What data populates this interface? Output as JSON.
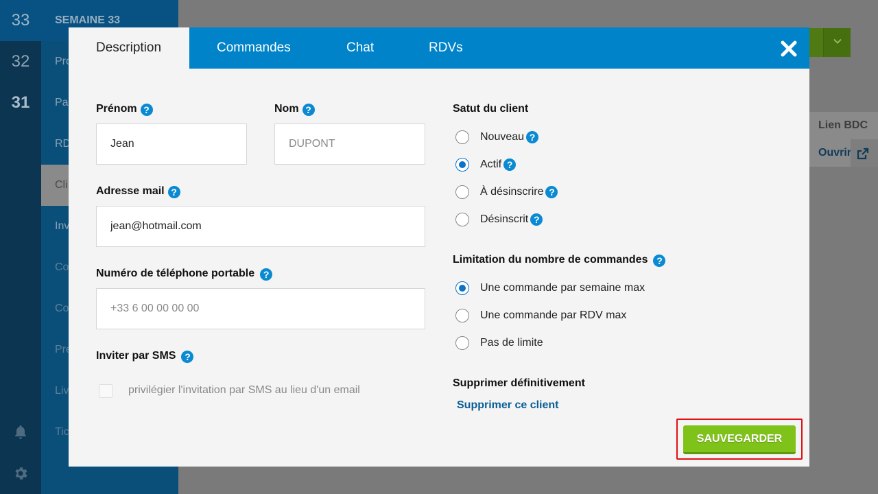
{
  "background": {
    "weeks": [
      {
        "number": "33"
      },
      {
        "number": "32"
      },
      {
        "number": "31"
      }
    ],
    "nav_header": "SEMAINE 33",
    "nav_items": [
      "Pro",
      "Pa",
      "RD",
      "Cli",
      "Inv",
      "Co",
      "Co",
      "Pre",
      "Liv",
      "Tic"
    ],
    "panel": {
      "lien_label": "Lien BDC",
      "ouvrir_label": "Ouvrir"
    }
  },
  "modal": {
    "tabs": [
      {
        "label": "Description",
        "active": true
      },
      {
        "label": "Commandes",
        "active": false
      },
      {
        "label": "Chat",
        "active": false
      },
      {
        "label": "RDVs",
        "active": false
      }
    ],
    "form": {
      "prenom": {
        "label": "Prénom",
        "value": "Jean",
        "placeholder": ""
      },
      "nom": {
        "label": "Nom",
        "value": "",
        "placeholder": "DUPONT"
      },
      "email": {
        "label": "Adresse mail",
        "value": "jean@hotmail.com",
        "placeholder": ""
      },
      "phone": {
        "label": "Numéro de téléphone portable",
        "value": "",
        "placeholder": "+33 6 00 00 00 00"
      },
      "sms": {
        "label": "Inviter par SMS",
        "checkbox_label": "privilégier l'invitation par SMS au lieu d'un email",
        "checked": false
      }
    },
    "status": {
      "label": "Satut du client",
      "options": [
        {
          "label": "Nouveau",
          "checked": false
        },
        {
          "label": "Actif",
          "checked": true
        },
        {
          "label": "À désinscrire",
          "checked": false
        },
        {
          "label": "Désinscrit",
          "checked": false
        }
      ]
    },
    "limit": {
      "label": "Limitation du nombre de commandes",
      "options": [
        {
          "label": "Une commande par semaine max",
          "checked": true
        },
        {
          "label": "Une commande par RDV max",
          "checked": false
        },
        {
          "label": "Pas de limite",
          "checked": false
        }
      ]
    },
    "delete": {
      "label": "Supprimer définitivement",
      "link": "Supprimer ce client"
    },
    "save_label": "SAUVEGARDER",
    "help_glyph": "?"
  },
  "colors": {
    "tab_bar": "#0083c9",
    "save_button": "#7fc21a",
    "highlight_border": "#e01010",
    "radio_checked": "#0a72c9"
  },
  "icons": [
    "close-icon",
    "help-icon",
    "bell-icon",
    "gear-icon",
    "chevron-down-icon",
    "external-link-icon"
  ]
}
